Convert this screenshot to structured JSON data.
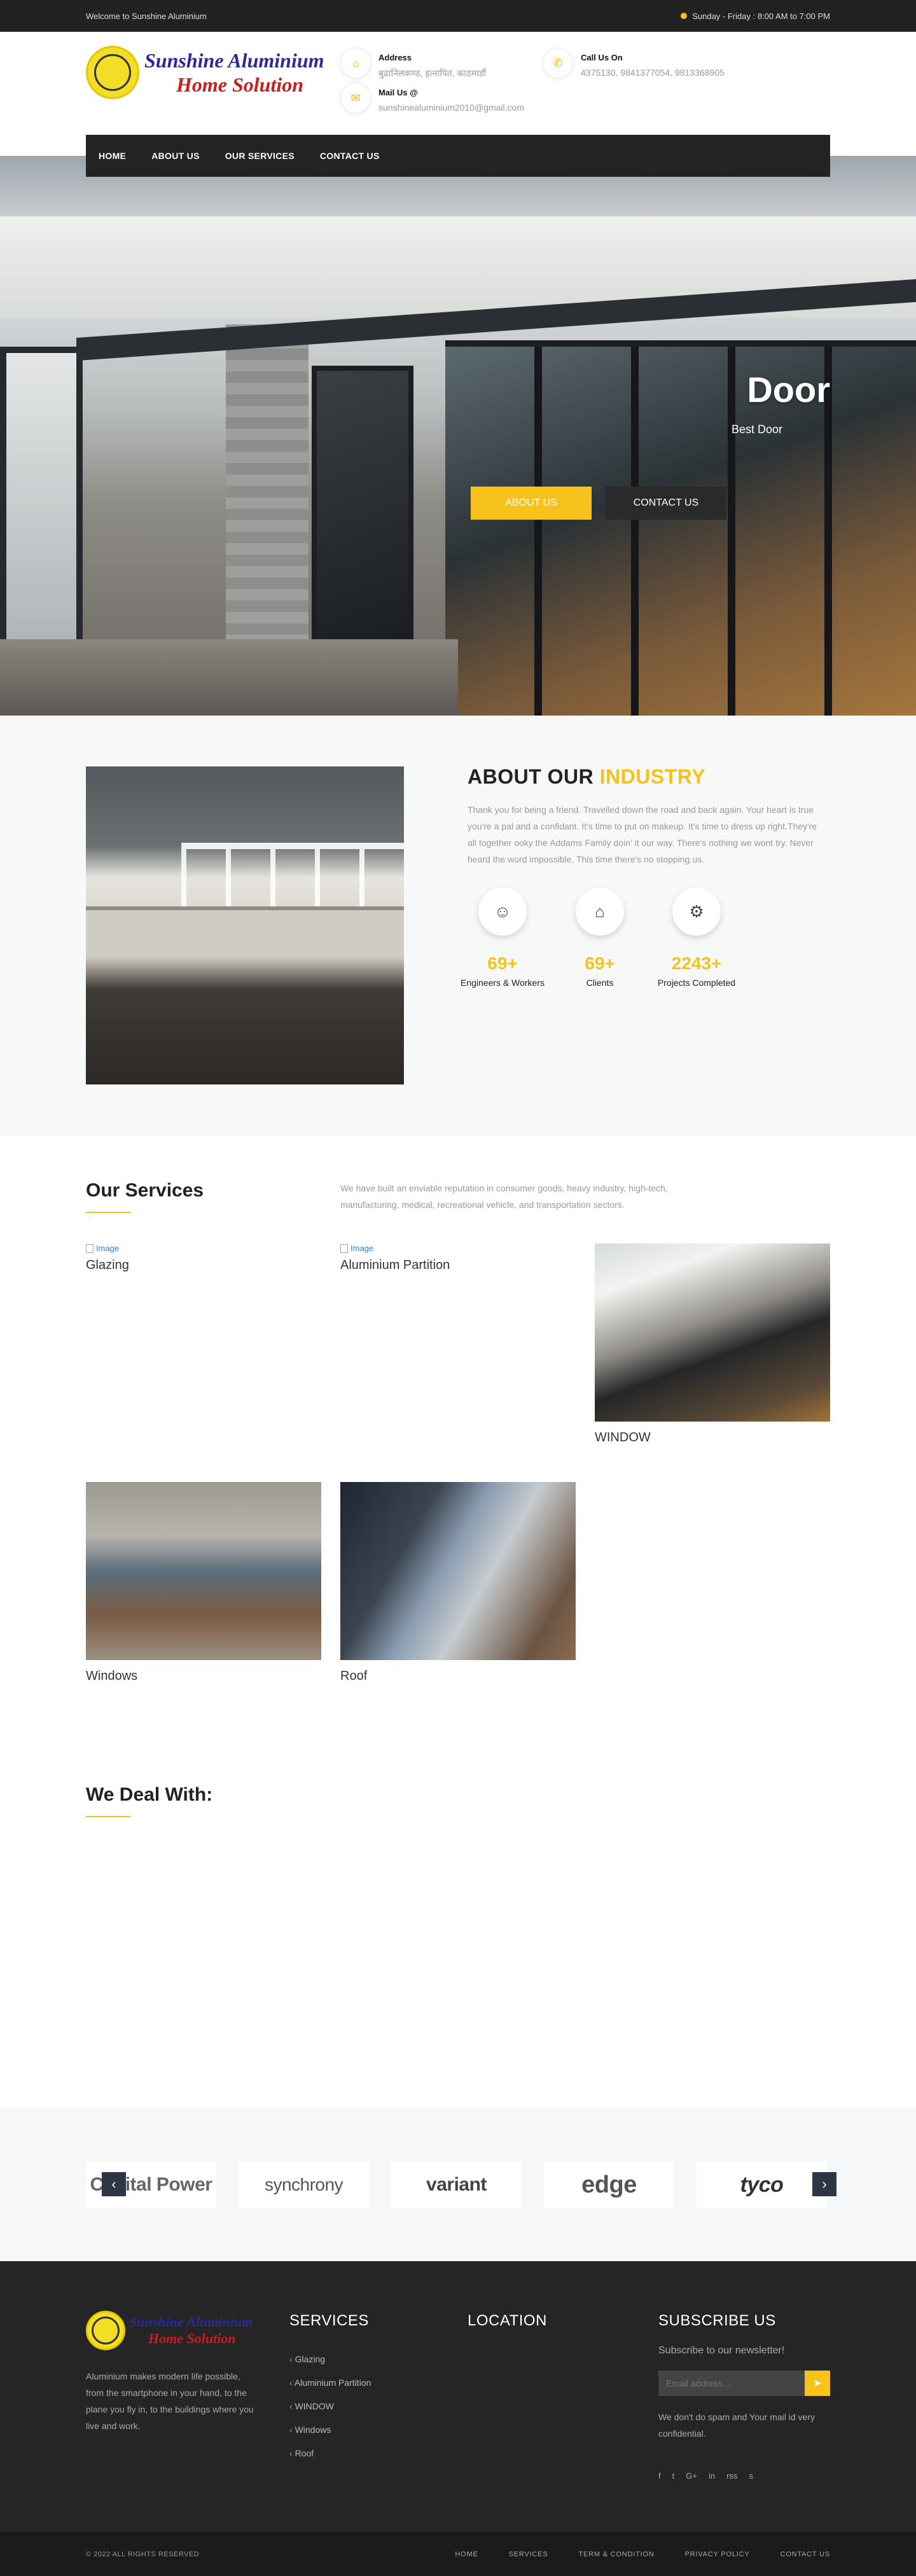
{
  "topbar": {
    "welcome": "Welcome to Sunshine Aluminium",
    "hours": "Sunday - Friday : 8:00 AM to 7:00 PM"
  },
  "logo": {
    "line1": "Sunshine Aluminium",
    "line2": "Home Solution"
  },
  "contact": {
    "address_label": "Address",
    "address_value": "बुढानिलकण्ठ, इत्नापित, काठमाडौं",
    "call_label": "Call Us On",
    "call_value": "4375130, 9841377054, 9813368905",
    "mail_label": "Mail Us @",
    "mail_value": "sunshinealuminium2010@gmail.com"
  },
  "nav": {
    "items": [
      "HOME",
      "ABOUT US",
      "OUR SERVICES",
      "CONTACT US"
    ]
  },
  "hero": {
    "title": "Door",
    "subtitle": "Best Door",
    "btn_about": "ABOUT US",
    "btn_contact": "CONTACT US"
  },
  "about": {
    "title_prefix": "ABOUT OUR",
    "title_accent": "INDUSTRY",
    "text": "Thank you for being a friend. Travelled down the road and back again. Your heart is true you're a pal and a confidant. It's time to put on makeup. It's time to dress up right.They're all together ooky the Addams Family doin' it our way. There's nothing we wont try. Never heard the word impossible. This time there's no stopping us.",
    "stats": [
      {
        "value": "69+",
        "label": "Engineers & Workers"
      },
      {
        "value": "69+",
        "label": "Clients"
      },
      {
        "value": "2243+",
        "label": "Projects Completed"
      }
    ]
  },
  "services": {
    "title": "Our Services",
    "intro": "We have built an enviable reputation in consumer goods, heavy industry, high-tech, manufacturing, medical, recreational vehicle, and transportation sectors.",
    "image_alt": "Image",
    "items": [
      "Glazing",
      "Aluminium Partition",
      "WINDOW",
      "Windows",
      "Roof"
    ]
  },
  "deal": {
    "title": "We Deal With:"
  },
  "clients": {
    "logos": [
      "Capital Power",
      "synchrony",
      "variant",
      "edge",
      "tyco"
    ]
  },
  "footer": {
    "logo_line1": "Sunshine Aluminium",
    "logo_line2": "Home Solution",
    "about": "Aluminium makes modern life possible, from the smartphone in your hand, to the plane you fly in, to the buildings where you live and work.",
    "services_title": "SERVICES",
    "services_items": [
      "Glazing",
      "Aluminium Partition",
      "WINDOW",
      "Windows",
      "Roof"
    ],
    "location_title": "LOCATION",
    "subscribe_title": "SUBSCRIBE US",
    "subscribe_text": "Subscribe to our newsletter!",
    "email_placeholder": "Email address...",
    "note": "We don't do spam and Your mail id very confidential.",
    "social": [
      "f",
      "t",
      "G+",
      "in",
      "rss",
      "s"
    ]
  },
  "bottom": {
    "copy": "© 2022 ALL RIGHTS RESERVED",
    "links": [
      "HOME",
      "SERVICES",
      "TERM & CONDITION",
      "PRIVACY POLICY",
      "CONTACT US"
    ]
  },
  "colors": {
    "accent": "#f7c21c",
    "dark": "#232323"
  }
}
